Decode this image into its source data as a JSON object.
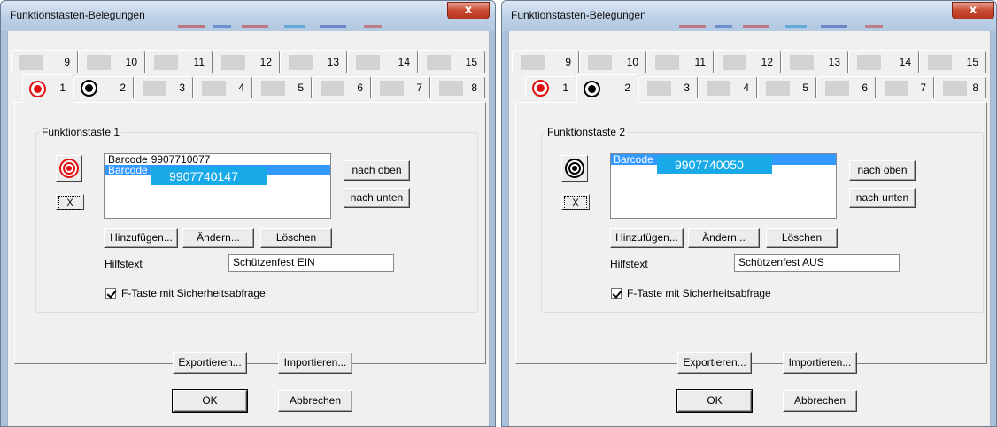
{
  "colors": {
    "selection": "#3399ff",
    "code_highlight": "#17a9e8",
    "close_button": "#c8472f",
    "frame": "#a9c1da",
    "active_icon_red": "#e01010"
  },
  "dialogs": [
    {
      "title": "Funktionstasten-Belegungen",
      "close_label": "x",
      "tabs_row1": [
        "9",
        "10",
        "11",
        "12",
        "13",
        "14",
        "15"
      ],
      "tabs_row2": [
        "1",
        "2",
        "3",
        "4",
        "5",
        "6",
        "7",
        "8"
      ],
      "active_tab": "1",
      "group_label": "Funktionstaste 1",
      "key_icon": "red-target-icon",
      "list_items": [
        {
          "label": "Barcode",
          "code": "9907710077"
        },
        {
          "label": "Barcode",
          "code": ""
        }
      ],
      "highlighted_code": "9907740147",
      "buttons": {
        "up": "nach oben",
        "down": "nach unten",
        "add": "Hinzufügen...",
        "change": "Ändern...",
        "delete": "Löschen",
        "x_label": "X",
        "export": "Exportieren...",
        "import": "Importieren...",
        "ok": "OK",
        "cancel": "Abbrechen"
      },
      "hilfstext_label": "Hilfstext",
      "hilfstext_value": "Schützenfest EIN",
      "checkbox_label": "F-Taste mit Sicherheitsabfrage",
      "checkbox_checked": true
    },
    {
      "title": "Funktionstasten-Belegungen",
      "close_label": "x",
      "tabs_row1": [
        "9",
        "10",
        "11",
        "12",
        "13",
        "14",
        "15"
      ],
      "tabs_row2": [
        "1",
        "2",
        "3",
        "4",
        "5",
        "6",
        "7",
        "8"
      ],
      "active_tab": "2",
      "group_label": "Funktionstaste 2",
      "key_icon": "black-target-icon",
      "list_items": [
        {
          "label": "Barcode",
          "code": ""
        }
      ],
      "highlighted_code": "9907740050",
      "buttons": {
        "up": "nach oben",
        "down": "nach unten",
        "add": "Hinzufügen...",
        "change": "Ändern...",
        "delete": "Löschen",
        "x_label": "X",
        "export": "Exportieren...",
        "import": "Importieren...",
        "ok": "OK",
        "cancel": "Abbrechen"
      },
      "hilfstext_label": "Hilfstext",
      "hilfstext_value": "Schützenfest AUS",
      "checkbox_label": "F-Taste mit Sicherheitsabfrage",
      "checkbox_checked": true
    }
  ]
}
